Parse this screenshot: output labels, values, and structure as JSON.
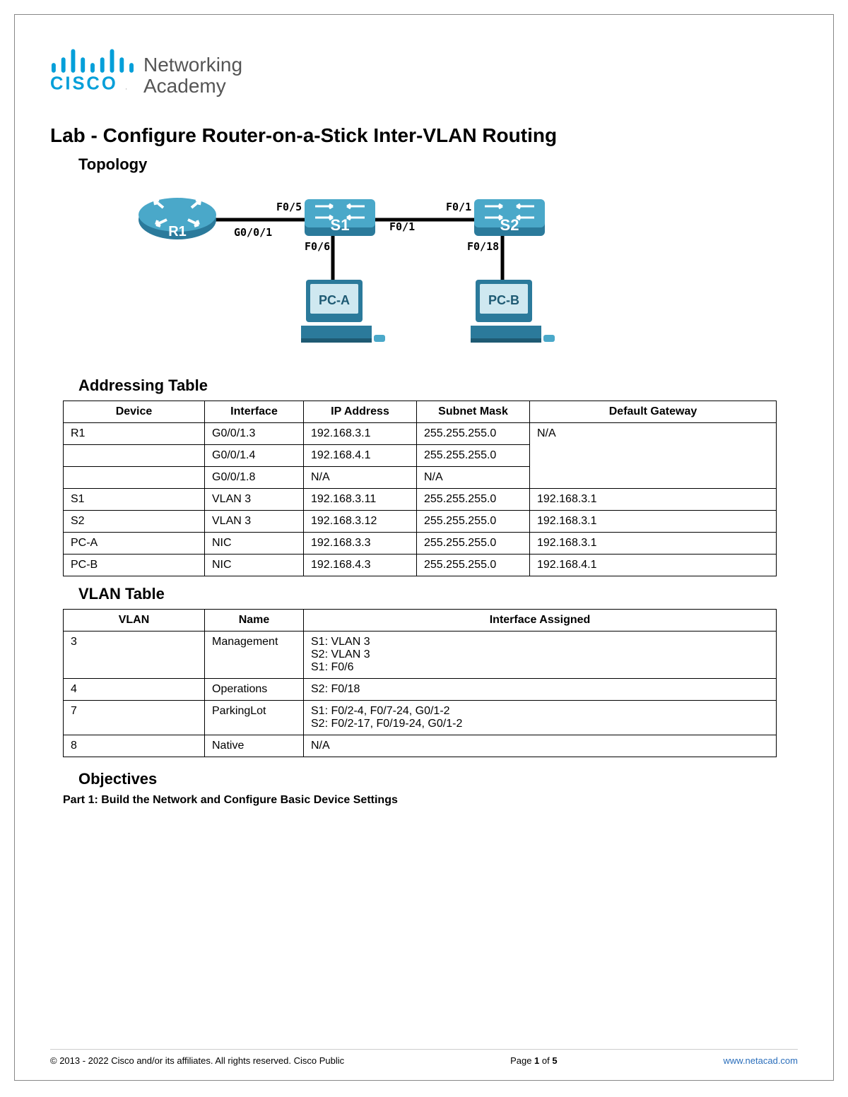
{
  "logo": {
    "line1": "Networking",
    "line2": "Academy"
  },
  "title": "Lab - Configure Router-on-a-Stick Inter-VLAN Routing",
  "topology_heading": "Topology",
  "topology": {
    "devices": {
      "router": "R1",
      "switch1": "S1",
      "switch2": "S2",
      "pc1": "PC-A",
      "pc2": "PC-B"
    },
    "links": {
      "r1_s1_r": "G0/0/1",
      "r1_s1_s": "F0/5",
      "s1_pc": "F0/6",
      "s1_s2_l": "F0/1",
      "s1_s2_r": "F0/1",
      "s2_pc": "F0/18"
    }
  },
  "addressing_heading": "Addressing Table",
  "addressing_headers": [
    "Device",
    "Interface",
    "IP Address",
    "Subnet Mask",
    "Default Gateway"
  ],
  "addressing_rows": [
    [
      "R1",
      "G0/0/1.3",
      "192.168.3.1",
      "255.255.255.0",
      "N/A"
    ],
    [
      "",
      "G0/0/1.4",
      "192.168.4.1",
      "255.255.255.0",
      ""
    ],
    [
      "",
      "G0/0/1.8",
      "N/A",
      "N/A",
      ""
    ],
    [
      "S1",
      "VLAN 3",
      "192.168.3.11",
      "255.255.255.0",
      "192.168.3.1"
    ],
    [
      "S2",
      "VLAN 3",
      "192.168.3.12",
      "255.255.255.0",
      "192.168.3.1"
    ],
    [
      "PC-A",
      "NIC",
      "192.168.3.3",
      "255.255.255.0",
      "192.168.3.1"
    ],
    [
      "PC-B",
      "NIC",
      "192.168.4.3",
      "255.255.255.0",
      "192.168.4.1"
    ]
  ],
  "vlan_heading": "VLAN Table",
  "vlan_headers": [
    "VLAN",
    "Name",
    "Interface Assigned"
  ],
  "vlan_rows": [
    [
      "3",
      "Management",
      "S1: VLAN 3\nS2: VLAN 3\nS1: F0/6"
    ],
    [
      "4",
      "Operations",
      "S2: F0/18"
    ],
    [
      "7",
      "ParkingLot",
      "S1: F0/2-4, F0/7-24, G0/1-2\nS2: F0/2-17, F0/19-24, G0/1-2"
    ],
    [
      "8",
      "Native",
      "N/A"
    ]
  ],
  "objectives_heading": "Objectives",
  "objectives_part1": "Part 1: Build the Network and Configure Basic Device Settings",
  "footer": {
    "copyright": "© 2013 - 2022 Cisco and/or its affiliates. All rights reserved. Cisco Public",
    "page": "Page 1 of 5",
    "url": "www.netacad.com"
  }
}
